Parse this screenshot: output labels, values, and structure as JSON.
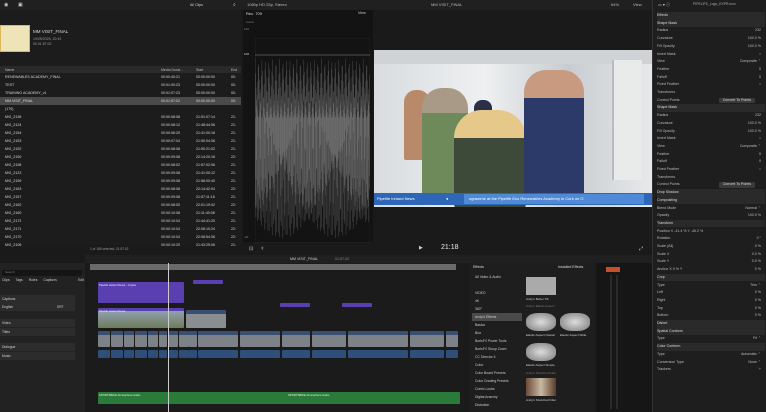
{
  "browser": {
    "filter": "All Clips",
    "project_title": "MM VISIT_FINAL",
    "project_date": "19/05/2025, 20:43",
    "project_duration": "00:01:57:02",
    "columns": [
      "Name",
      "Media Durat...",
      "Start",
      "End"
    ],
    "rows": [
      [
        "RENEWABLES ACADEMY_FINAL",
        "00:00:40:21",
        "00:00:00:00",
        "00:"
      ],
      [
        "TEST",
        "00:01:00:23",
        "00:00:00:00",
        "00:"
      ],
      [
        "TRAINING ACADEMY_v1",
        "00:01:07:23",
        "00:00:00:00",
        "00:"
      ],
      [
        "MM VISIT_FINAL",
        "00:01:57:02",
        "00:00:00:00",
        "00:"
      ],
      [
        "(170)",
        "",
        "",
        ""
      ],
      [
        "MVI_2136",
        "00:00:08:08",
        "21:51:07:14",
        "21:"
      ],
      [
        "MVI_2124",
        "00:00:08:12",
        "21:48:44:06",
        "21:"
      ],
      [
        "MVI_2154",
        "00:00:06:20",
        "21:41:00:18",
        "21:"
      ],
      [
        "MVI_2153",
        "00:00:07:04",
        "21:50:04:08",
        "21:"
      ],
      [
        "MVI_2152",
        "00:00:08:08",
        "21:50:21:02",
        "21:"
      ],
      [
        "MVI_2150",
        "00:00:09:08",
        "22:14:20:16",
        "22:"
      ],
      [
        "MVI_2158",
        "00:00:08:02",
        "21:57:02:06",
        "21:"
      ],
      [
        "MVI_2123",
        "00:00:09:08",
        "21:41:00:12",
        "21:"
      ],
      [
        "MVI_2159",
        "00:00:09:08",
        "21:58:00:40",
        "21:"
      ],
      [
        "MVI_2163",
        "00:00:08:08",
        "22:14:42:04",
        "22:"
      ],
      [
        "MVI_2157",
        "00:00:09:08",
        "21:57:11:16",
        "21:"
      ],
      [
        "MVI_2162",
        "00:00:08:00",
        "22:01:19:02",
        "22:"
      ],
      [
        "MVI_2160",
        "00:00:10:08",
        "21:11:40:08",
        "21:"
      ],
      [
        "MVI_2172",
        "00:00:10:04",
        "21:44:41:20",
        "21:"
      ],
      [
        "MVI_2171",
        "00:00:10:04",
        "22:08:10:24",
        "22:"
      ],
      [
        "MVI_2170",
        "00:00:10:04",
        "22:08:54:08",
        "22:"
      ],
      [
        "MVI_2106",
        "00:00:10:20",
        "21:43:25:06",
        "21:"
      ]
    ],
    "status": "1 of 185 selected, 01:57:02"
  },
  "viewer": {
    "format": "1080p HD 25p, Stereo",
    "title": "MM VISIT_FINAL",
    "zoom": "64%",
    "view": "View",
    "timecode": "21:18",
    "lower_third_left": "Pipelife Ireland News",
    "lower_third_ticker": "ogramme at the Pipelife Eco Renewables Academy in Cork on O"
  },
  "scope": {
    "title": "Rec. 709",
    "view": "View",
    "label": "Luma",
    "top": "120",
    "mid": "100",
    "bottom": "-20"
  },
  "inspector": {
    "file": "PIPELIFE_Logo_EXPR.mov",
    "rows": [
      {
        "l": "Effects",
        "sec": true
      },
      {
        "l": "Shape Mask",
        "sec": true
      },
      {
        "l": "Radius",
        "v": "232"
      },
      {
        "l": "Curvature",
        "v": "100.0 %"
      },
      {
        "l": "Fill Opacity",
        "v": "100.0 %"
      },
      {
        "l": "Invert Mask",
        "v": "○"
      },
      {
        "l": "View",
        "v": "Composite ⌃"
      },
      {
        "l": "Feather",
        "v": "0"
      },
      {
        "l": "Falloff",
        "v": "0"
      },
      {
        "l": "Fixed Feather",
        "v": "○"
      },
      {
        "l": "Transforms",
        "v": ""
      },
      {
        "l": "Control Points",
        "btn": "Convert To Points"
      },
      {
        "l": "Shape Mask",
        "sec": true
      },
      {
        "l": "Radius",
        "v": "232"
      },
      {
        "l": "Curvature",
        "v": "100.0 %"
      },
      {
        "l": "Fill Opacity",
        "v": "100.0 %"
      },
      {
        "l": "Invert Mask",
        "v": "○"
      },
      {
        "l": "View",
        "v": "Composite ⌃"
      },
      {
        "l": "Feather",
        "v": "0"
      },
      {
        "l": "Falloff",
        "v": "0"
      },
      {
        "l": "Fixed Feather",
        "v": "○"
      },
      {
        "l": "Transforms",
        "v": ""
      },
      {
        "l": "Control Points",
        "btn": "Convert To Points"
      },
      {
        "l": "Drop Shadow",
        "sec": true
      },
      {
        "l": "Compositing",
        "sec": true
      },
      {
        "l": "Blend Mode",
        "v": "Normal ⌃"
      },
      {
        "l": "Opacity",
        "v": "100.0 %"
      },
      {
        "l": "Transform",
        "sec": true
      },
      {
        "l": "Position  X  -41.4 %  Y  -46.2 %",
        "v": ""
      },
      {
        "l": "Rotation",
        "v": "0 °"
      },
      {
        "l": "Scale (All)",
        "v": "0 %"
      },
      {
        "l": "Scale X",
        "v": "0.0 %"
      },
      {
        "l": "Scale Y",
        "v": "0.0 %"
      },
      {
        "l": "Anchor  X  0 %  Y",
        "v": "0 %"
      },
      {
        "l": "Crop",
        "sec": true
      },
      {
        "l": "Type",
        "v": "Trim ⌃"
      },
      {
        "l": "Left",
        "v": "0 %"
      },
      {
        "l": "Right",
        "v": "0 %"
      },
      {
        "l": "Top",
        "v": "0 %"
      },
      {
        "l": "Bottom",
        "v": "0 %"
      },
      {
        "l": "Distort",
        "sec": true
      },
      {
        "l": "Spatial Conform",
        "sec": true
      },
      {
        "l": "Type",
        "v": "Fit ⌃"
      },
      {
        "l": "Color Conform",
        "sec": true
      },
      {
        "l": "Type",
        "v": "Automatic ⌃"
      },
      {
        "l": "Conversion Type",
        "v": "None ⌃"
      },
      {
        "l": "Trackers",
        "v": "+"
      }
    ]
  },
  "timeline": {
    "project": "MM VISIT_FINAL",
    "duration": "01:57:02",
    "clips": {
      "title": "Pipelife Ireland News - Crysta",
      "lower": "Pipelife Ireland News",
      "audio1": "SPORTSBIKE Atmosphere Audio",
      "audio2": "SPORTSBIKE Atmosphere Audio"
    }
  },
  "index": {
    "tabs": [
      "Clips",
      "Tags",
      "Roles",
      "Captions"
    ],
    "edit": "Edit",
    "search": "Search",
    "roles": [
      "Captions",
      "English"
    ],
    "lang_code": "SRT",
    "groups": [
      "Video",
      "Titles"
    ],
    "audio": [
      "Dialogue",
      "Music"
    ]
  },
  "effects": {
    "title": "Effects",
    "installed": "Installed Effects",
    "categories": [
      "All Video & Audio",
      "",
      "VIDEO",
      "4K",
      "360°",
      "Andy's Effects",
      "Basics",
      "Blur",
      "BorisFX Power Tools",
      "BorisFX Stoop Zoom",
      "CC Director 4",
      "Color",
      "Color Board Presets",
      "Color Grading Presets",
      "Comic Looks",
      "Digital Anarchy",
      "Distortion"
    ],
    "items": [
      {
        "name": "Andy's Better Tilt",
        "group": ""
      },
      {
        "name": "Elastic Aspect Classic",
        "group": "Andy's Elastic Aspect"
      },
      {
        "name": "Elastic Aspect Wide",
        "group": ""
      },
      {
        "name": "Elastic Aspect Simple",
        "group": ""
      },
      {
        "name": "Andy's Stretched Filter",
        "group": "Andy's Stretched Filter"
      }
    ]
  }
}
